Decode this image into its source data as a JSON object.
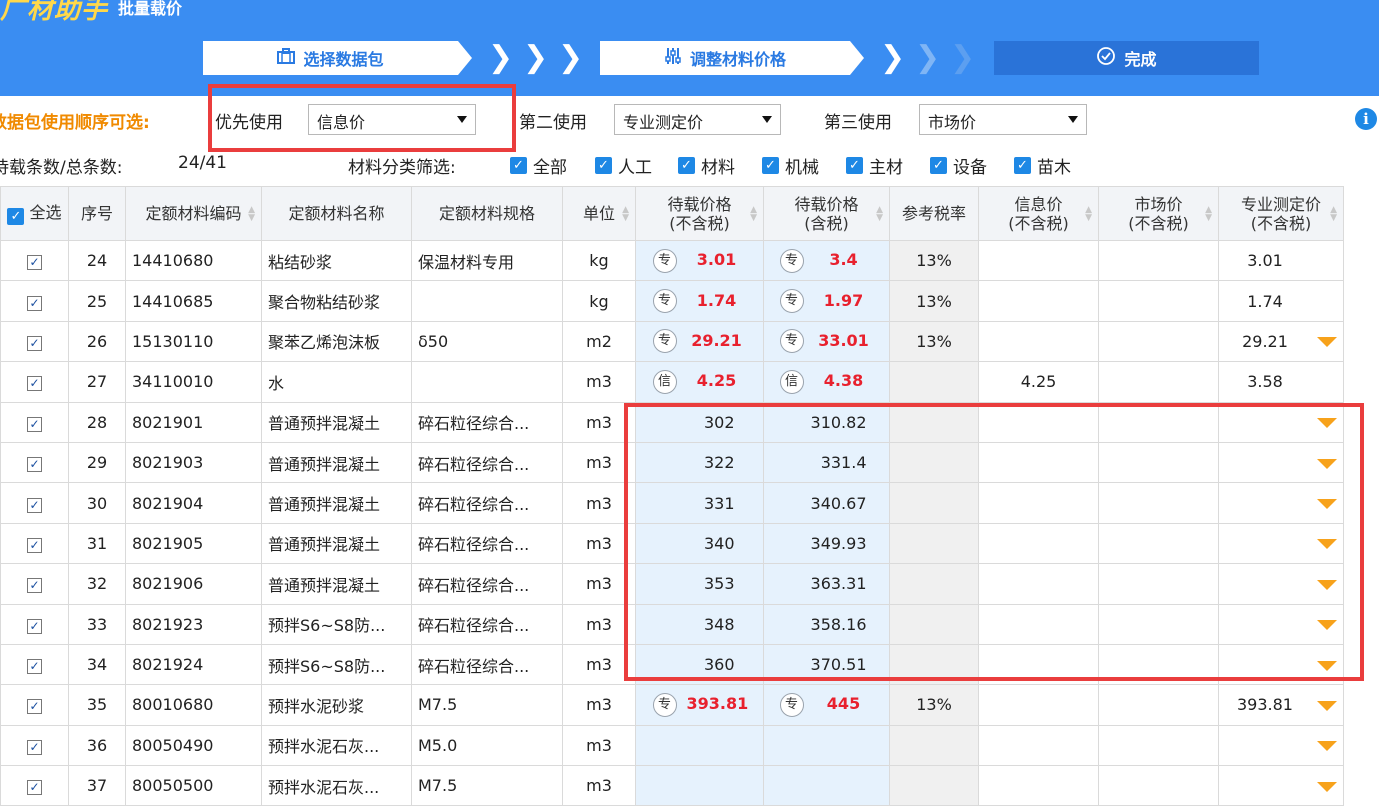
{
  "app": {
    "brand": "广材助手",
    "title": "批量载价"
  },
  "steps": [
    {
      "label": "选择数据包",
      "icon": "briefcase-icon"
    },
    {
      "label": "调整材料价格",
      "icon": "sliders-icon"
    },
    {
      "label": "完成",
      "icon": "check-circle-icon"
    }
  ],
  "order": {
    "label": "数据包使用顺序可选:",
    "first_label": "优先使用",
    "first_value": "信息价",
    "second_label": "第二使用",
    "second_value": "专业测定价",
    "third_label": "第三使用",
    "third_value": "市场价"
  },
  "stats": {
    "label": "待载条数/总条数:",
    "value": "24/41",
    "filter_label": "材料分类筛选:"
  },
  "filters": [
    "全部",
    "人工",
    "材料",
    "机械",
    "主材",
    "设备",
    "苗木"
  ],
  "table": {
    "headers": {
      "select_all": "全选",
      "seq": "序号",
      "code": "定额材料编码",
      "name": "定额材料名称",
      "spec": "定额材料规格",
      "unit": "单位",
      "price_ex1": "待载价格",
      "price_ex2": "(不含税)",
      "price_in1": "待载价格",
      "price_in2": "(含税)",
      "tax": "参考税率",
      "info1": "信息价",
      "info2": "(不含税)",
      "market1": "市场价",
      "market2": "(不含税)",
      "pro1": "专业测定价",
      "pro2": "(不含税)"
    },
    "rows": [
      {
        "seq": "24",
        "code": "14410680",
        "name": "粘结砂浆",
        "spec": "保温材料专用",
        "unit": "kg",
        "tag_ex": "专",
        "price_ex": "3.01",
        "tag_in": "专",
        "price_in": "3.4",
        "tax": "13%",
        "info": "",
        "market": "",
        "pro": "3.01",
        "dropdown": false
      },
      {
        "seq": "25",
        "code": "14410685",
        "name": "聚合物粘结砂浆",
        "spec": "",
        "unit": "kg",
        "tag_ex": "专",
        "price_ex": "1.74",
        "tag_in": "专",
        "price_in": "1.97",
        "tax": "13%",
        "info": "",
        "market": "",
        "pro": "1.74",
        "dropdown": false
      },
      {
        "seq": "26",
        "code": "15130110",
        "name": "聚苯乙烯泡沫板",
        "spec": "δ50",
        "unit": "m2",
        "tag_ex": "专",
        "price_ex": "29.21",
        "tag_in": "专",
        "price_in": "33.01",
        "tax": "13%",
        "info": "",
        "market": "",
        "pro": "29.21",
        "dropdown": true
      },
      {
        "seq": "27",
        "code": "34110010",
        "name": "水",
        "spec": "",
        "unit": "m3",
        "tag_ex": "信",
        "price_ex": "4.25",
        "tag_in": "信",
        "price_in": "4.38",
        "tax": "",
        "info": "4.25",
        "market": "",
        "pro": "3.58",
        "dropdown": false
      },
      {
        "seq": "28",
        "code": "8021901",
        "name": "普通预拌混凝土",
        "spec": "碎石粒径综合...",
        "unit": "m3",
        "tag_ex": "",
        "price_ex": "302",
        "tag_in": "",
        "price_in": "310.82",
        "tax": "",
        "info": "",
        "market": "",
        "pro": "",
        "dropdown": true
      },
      {
        "seq": "29",
        "code": "8021903",
        "name": "普通预拌混凝土",
        "spec": "碎石粒径综合...",
        "unit": "m3",
        "tag_ex": "",
        "price_ex": "322",
        "tag_in": "",
        "price_in": "331.4",
        "tax": "",
        "info": "",
        "market": "",
        "pro": "",
        "dropdown": true
      },
      {
        "seq": "30",
        "code": "8021904",
        "name": "普通预拌混凝土",
        "spec": "碎石粒径综合...",
        "unit": "m3",
        "tag_ex": "",
        "price_ex": "331",
        "tag_in": "",
        "price_in": "340.67",
        "tax": "",
        "info": "",
        "market": "",
        "pro": "",
        "dropdown": true
      },
      {
        "seq": "31",
        "code": "8021905",
        "name": "普通预拌混凝土",
        "spec": "碎石粒径综合...",
        "unit": "m3",
        "tag_ex": "",
        "price_ex": "340",
        "tag_in": "",
        "price_in": "349.93",
        "tax": "",
        "info": "",
        "market": "",
        "pro": "",
        "dropdown": true
      },
      {
        "seq": "32",
        "code": "8021906",
        "name": "普通预拌混凝土",
        "spec": "碎石粒径综合...",
        "unit": "m3",
        "tag_ex": "",
        "price_ex": "353",
        "tag_in": "",
        "price_in": "363.31",
        "tax": "",
        "info": "",
        "market": "",
        "pro": "",
        "dropdown": true
      },
      {
        "seq": "33",
        "code": "8021923",
        "name": "预拌S6~S8防...",
        "spec": "碎石粒径综合...",
        "unit": "m3",
        "tag_ex": "",
        "price_ex": "348",
        "tag_in": "",
        "price_in": "358.16",
        "tax": "",
        "info": "",
        "market": "",
        "pro": "",
        "dropdown": true
      },
      {
        "seq": "34",
        "code": "8021924",
        "name": "预拌S6~S8防...",
        "spec": "碎石粒径综合...",
        "unit": "m3",
        "tag_ex": "",
        "price_ex": "360",
        "tag_in": "",
        "price_in": "370.51",
        "tax": "",
        "info": "",
        "market": "",
        "pro": "",
        "dropdown": true
      },
      {
        "seq": "35",
        "code": "80010680",
        "name": "预拌水泥砂浆",
        "spec": "M7.5",
        "unit": "m3",
        "tag_ex": "专",
        "price_ex": "393.81",
        "tag_in": "专",
        "price_in": "445",
        "tax": "13%",
        "info": "",
        "market": "",
        "pro": "393.81",
        "dropdown": true
      },
      {
        "seq": "36",
        "code": "80050490",
        "name": "预拌水泥石灰...",
        "spec": "M5.0",
        "unit": "m3",
        "tag_ex": "",
        "price_ex": "",
        "tag_in": "",
        "price_in": "",
        "tax": "",
        "info": "",
        "market": "",
        "pro": "",
        "dropdown": true
      },
      {
        "seq": "37",
        "code": "80050500",
        "name": "预拌水泥石灰...",
        "spec": "M7.5",
        "unit": "m3",
        "tag_ex": "",
        "price_ex": "",
        "tag_in": "",
        "price_in": "",
        "tax": "",
        "info": "",
        "market": "",
        "pro": "",
        "dropdown": true
      }
    ]
  },
  "colors": {
    "header_bg": "#3a8df2",
    "accent_orange": "#f08a00",
    "price_red": "#e8212e",
    "highlight_red": "#ea3d3d",
    "price_col_bg": "#e6f2fd"
  }
}
